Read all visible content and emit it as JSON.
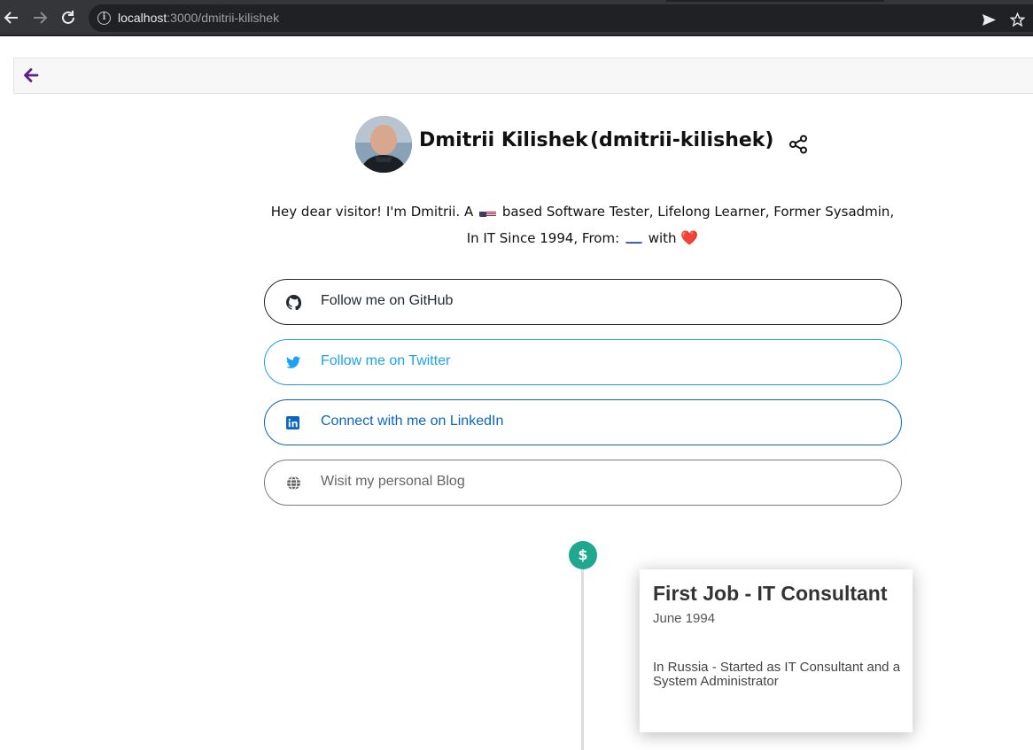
{
  "browser": {
    "url_host": "localhost",
    "url_rest": ":3000/dmitrii-kilishek",
    "back_icon": "arrow-left-icon",
    "forward_icon": "arrow-right-icon",
    "reload_icon": "reload-icon",
    "info_icon": "info-icon",
    "send_icon": "send-icon",
    "bookmark_icon": "star-icon"
  },
  "page": {
    "back_icon": "arrow-left-icon",
    "accent": "#5b1f8a"
  },
  "profile": {
    "name": "Dmitrii Kilishek",
    "handle": "(dmitrii-kilishek)",
    "share_icon": "share-icon",
    "bio_part1": "Hey dear visitor! I'm Dmitrii. A",
    "bio_part2": "based Software Tester, Lifelong Learner, Former Sysadmin,",
    "bio_part3": "In IT Since 1994, From:",
    "bio_part4": "with",
    "flag_from": "us-flag",
    "flag_origin": "ru-flag",
    "heart": "❤️"
  },
  "links": [
    {
      "label": "Follow me on GitHub",
      "icon": "github-icon",
      "color": "#24292e"
    },
    {
      "label": "Follow me on Twitter",
      "icon": "twitter-icon",
      "color": "#1da1f2"
    },
    {
      "label": "Connect with me on LinkedIn",
      "icon": "linkedin-icon",
      "color": "#0a66c2"
    },
    {
      "label": "Wisit my personal Blog",
      "icon": "globe-icon",
      "color": "#666666"
    }
  ],
  "timeline": {
    "dot_symbol": "$",
    "dot_color": "#1da88f",
    "items": [
      {
        "title": "First Job - IT Consultant",
        "date": "June 1994",
        "description": "In Russia - Started as IT Consultant and a System Administrator"
      }
    ]
  }
}
